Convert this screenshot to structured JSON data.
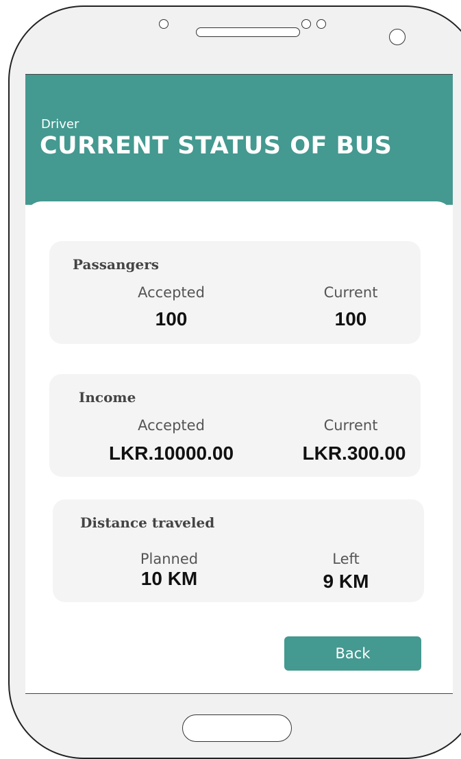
{
  "header": {
    "subtitle": "Driver",
    "title": "CURRENT STATUS OF BUS",
    "background": "#449990"
  },
  "cards": {
    "passengers": {
      "title": "Passangers",
      "left_label": "Accepted",
      "left_value": "100",
      "right_label": "Current",
      "right_value": "100"
    },
    "income": {
      "title": "Income",
      "left_label": "Accepted",
      "left_value": "LKR.10000.00",
      "right_label": "Current",
      "right_value": "LKR.300.00"
    },
    "distance": {
      "title": "Distance traveled",
      "left_label": "Planned",
      "left_value": "10 KM",
      "right_label": "Left",
      "right_value": "9 KM"
    }
  },
  "actions": {
    "back_label": "Back"
  },
  "colors": {
    "accent": "#449990",
    "card_bg": "#f4f4f4"
  }
}
